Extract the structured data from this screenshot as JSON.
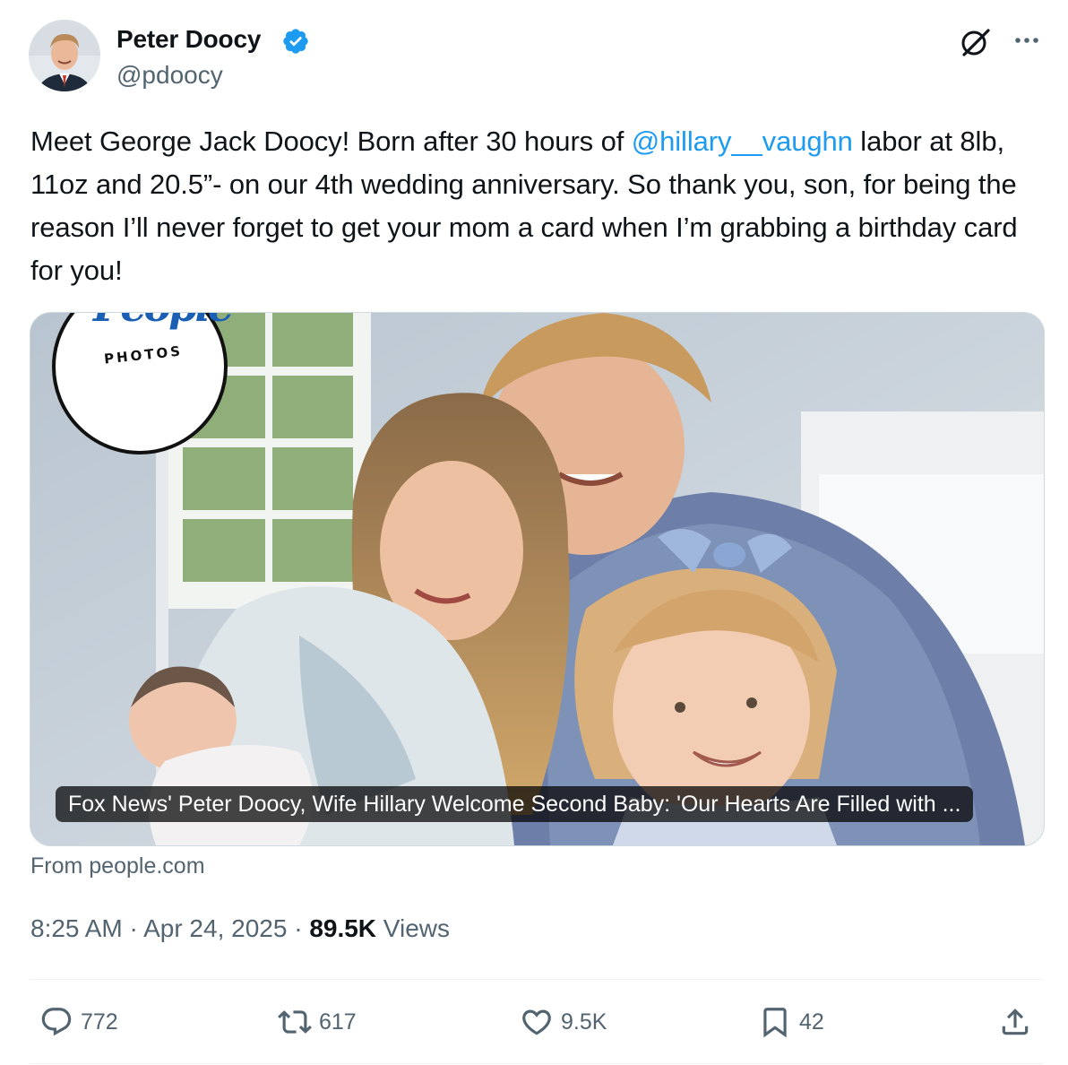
{
  "author": {
    "name": "Peter Doocy",
    "handle": "@pdoocy",
    "verified": true,
    "avatar_icon": "profile-photo"
  },
  "header_actions": {
    "grok_icon": "grok-icon",
    "more_icon": "more-icon"
  },
  "tweet": {
    "text_part1": "Meet George Jack Doocy! Born after 30 hours of ",
    "mention": "@hillary__vaughn",
    "text_part2": " labor at 8lb, 11oz and 20.5”- on our 4th wedding anniversary. So thank you, son, for being the reason I’ll never forget to get your mom a card when I’m grabbing a birthday card for you!"
  },
  "card": {
    "badge_logo": "People",
    "badge_sub": "PHOTOS",
    "caption": "Fox News' Peter Doocy, Wife Hillary Welcome Second Baby: 'Our Hearts Are Filled with ...",
    "source": "From people.com"
  },
  "meta": {
    "time": "8:25 AM",
    "sep1": " · ",
    "date": "Apr 24, 2025",
    "sep2": " · ",
    "views_count": "89.5K",
    "views_label": " Views"
  },
  "actions": {
    "replies": "772",
    "reposts": "617",
    "likes": "9.5K",
    "bookmarks": "42"
  },
  "colors": {
    "accent": "#1d9bf0",
    "text_primary": "#0f1419",
    "text_secondary": "#536471",
    "border": "#cfd9de"
  }
}
